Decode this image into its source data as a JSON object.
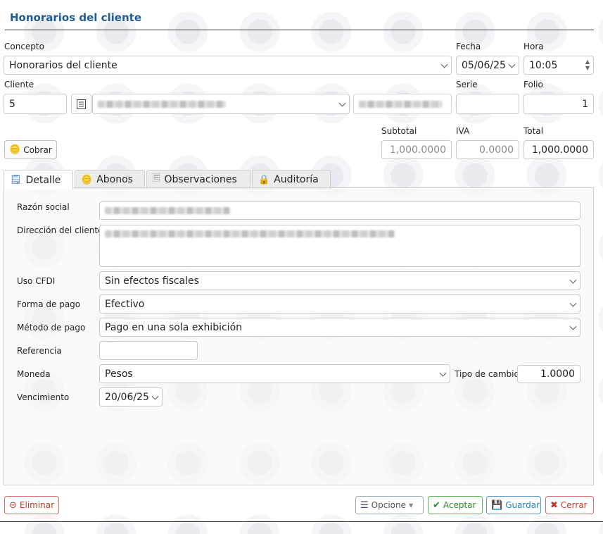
{
  "title": "Honorarios del cliente",
  "labels": {
    "concepto": "Concepto",
    "fecha": "Fecha",
    "hora": "Hora",
    "cliente": "Cliente",
    "serie": "Serie",
    "folio": "Folio",
    "subtotal": "Subtotal",
    "iva": "IVA",
    "total": "Total"
  },
  "values": {
    "concepto": "Honorarios del cliente",
    "fecha": "05/06/25",
    "hora": "10:05",
    "cliente_num": "5",
    "serie": "",
    "folio": "1",
    "subtotal": "1,000.0000",
    "iva": "0.0000",
    "total": "1,000.0000"
  },
  "buttons": {
    "cobrar": "Cobrar",
    "eliminar": "Eliminar",
    "opcione": "Opcione",
    "aceptar": "Aceptar",
    "guardar": "Guardar",
    "cerrar": "Cerrar"
  },
  "tabs": [
    {
      "label": "Detalle",
      "icon": "ledger-icon",
      "active": true
    },
    {
      "label": "Abonos",
      "icon": "coins-add-icon",
      "active": false
    },
    {
      "label": "Observaciones",
      "icon": "note-icon",
      "active": false
    },
    {
      "label": "Auditoría",
      "icon": "lock-icon",
      "active": false
    }
  ],
  "detail": {
    "razon_social_label": "Razón social",
    "direccion_label": "Dirección del cliente",
    "uso_cfdi_label": "Uso CFDI",
    "uso_cfdi": "Sin efectos fiscales",
    "forma_pago_label": "Forma de pago",
    "forma_pago": "Efectivo",
    "metodo_pago_label": "Método de pago",
    "metodo_pago": "Pago en una sola exhibición",
    "referencia_label": "Referencia",
    "referencia": "",
    "moneda_label": "Moneda",
    "moneda": "Pesos",
    "tipo_cambio_label": "Tipo de cambio",
    "tipo_cambio": "1.0000",
    "vencimiento_label": "Vencimiento",
    "vencimiento": "20/06/25"
  },
  "colors": {
    "title": "#1f5e95",
    "eliminar": "#c0392b",
    "aceptar": "#2e8b2e",
    "guardar": "#1f7fbf",
    "cerrar": "#c0392b"
  }
}
